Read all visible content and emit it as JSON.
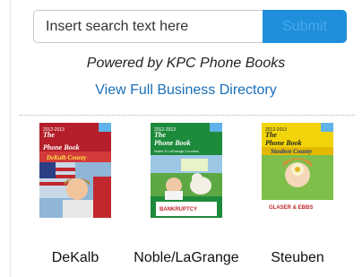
{
  "search": {
    "placeholder": "Insert search text here",
    "button_label": "Submit"
  },
  "powered_by": "Powered by KPC Phone Books",
  "directory_link": "View Full Business Directory",
  "books": [
    {
      "label": "DeKalb",
      "cover_title": "The Phone Book",
      "cover_region": "DeKalb County",
      "color": "#b51e2a"
    },
    {
      "label": "Noble/LaGrange",
      "cover_title": "The Phone Book",
      "cover_region": "Noble & LaGrange Counties",
      "color": "#1e8a3c"
    },
    {
      "label": "Steuben",
      "cover_title": "The Phone Book",
      "cover_region": "Steuben County",
      "color": "#f2d40a"
    }
  ],
  "colors": {
    "accent": "#1f8fdc",
    "link": "#1a6fb8"
  }
}
